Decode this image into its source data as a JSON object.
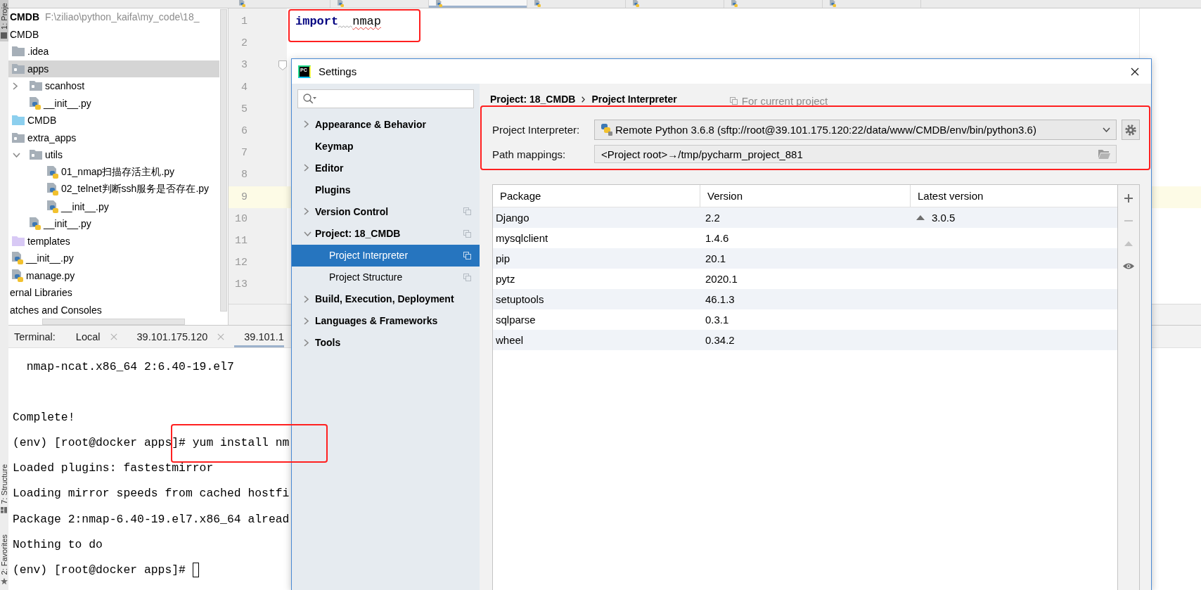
{
  "tool_windows": [
    {
      "kind": "project",
      "label": "1: Proje",
      "selected": true
    },
    {
      "kind": "structure",
      "label": "7: Structure",
      "selected": false
    },
    {
      "kind": "favorites",
      "label": "2: Favorites",
      "selected": false
    }
  ],
  "editor_tabs": [
    {
      "selected": false
    },
    {
      "selected": false
    },
    {
      "selected": true
    },
    {
      "selected": false
    },
    {
      "selected": false
    },
    {
      "selected": false
    },
    {
      "selected": false
    }
  ],
  "project_tree": {
    "items": [
      {
        "kind": "root",
        "label": "CMDB",
        "path": "F:\\ziliao\\python_kaifa\\my_code\\18_",
        "selected": false
      },
      {
        "kind": "label",
        "label": "CMDB",
        "selected": false,
        "children": [
          {
            "kind": "folder",
            "label": ".idea",
            "selected": false
          },
          {
            "kind": "package",
            "label": "apps",
            "selected": true,
            "children": [
              {
                "kind": "package",
                "label": "scanhost",
                "selected": false,
                "expanded": false
              },
              {
                "kind": "python_file",
                "label": "__init__.py",
                "selected": false
              }
            ]
          },
          {
            "kind": "source_folder",
            "label": "CMDB",
            "selected": false
          },
          {
            "kind": "package",
            "label": "extra_apps",
            "selected": false,
            "children": [
              {
                "kind": "package",
                "label": "utils",
                "selected": false,
                "expanded": true,
                "children": [
                  {
                    "kind": "python_file",
                    "label": "01_nmap扫描存活主机.py",
                    "selected": false
                  },
                  {
                    "kind": "python_file",
                    "label": "02_telnet判断ssh服务是否存在.py",
                    "selected": false
                  },
                  {
                    "kind": "python_file",
                    "label": "__init__.py",
                    "selected": false
                  }
                ]
              },
              {
                "kind": "python_file",
                "label": "__init__.py",
                "selected": false
              }
            ]
          },
          {
            "kind": "template_folder",
            "label": "templates",
            "selected": false
          },
          {
            "kind": "python_file",
            "label": "__init__.py",
            "selected": false
          },
          {
            "kind": "python_file",
            "label": "manage.py",
            "selected": false
          }
        ]
      },
      {
        "kind": "label",
        "label": "ernal Libraries",
        "selected": false
      },
      {
        "kind": "label",
        "label": "atches and Consoles",
        "selected": false
      }
    ]
  },
  "editor": {
    "lines": [
      {
        "number": "1",
        "tokens": [
          {
            "kind": "keyword",
            "text": "import",
            "warning_after": true,
            "error": false
          },
          {
            "kind": "name",
            "text": "nmap",
            "warning_after": false,
            "error": true
          }
        ],
        "current": false,
        "fold": false,
        "marked": true
      },
      {
        "number": "2",
        "current": false,
        "fold": false,
        "marked": false
      },
      {
        "number": "3",
        "current": false,
        "fold": true,
        "marked": false
      },
      {
        "number": "4",
        "current": false,
        "fold": false,
        "marked": false
      },
      {
        "number": "5",
        "current": false,
        "fold": false,
        "marked": false
      },
      {
        "number": "6",
        "current": false,
        "fold": false,
        "marked": false
      },
      {
        "number": "7",
        "current": false,
        "fold": false,
        "marked": false
      },
      {
        "number": "8",
        "current": false,
        "fold": false,
        "marked": false
      },
      {
        "number": "9",
        "current": true,
        "fold": false,
        "marked": false
      },
      {
        "number": "10",
        "current": false,
        "fold": false,
        "marked": false
      },
      {
        "number": "11",
        "current": false,
        "fold": false,
        "marked": false
      },
      {
        "number": "12",
        "current": false,
        "fold": false,
        "marked": false
      },
      {
        "number": "13",
        "current": false,
        "fold": false,
        "marked": false
      }
    ]
  },
  "terminal": {
    "title": "Terminal:",
    "tabs": [
      {
        "label": "Local",
        "closable": true,
        "selected": false
      },
      {
        "label": "39.101.175.120",
        "closable": true,
        "selected": false
      },
      {
        "label": "39.101.1",
        "closable": false,
        "selected": true
      }
    ],
    "blocks": [
      {
        "lines": [
          {
            "text": "  nmap-ncat.x86_64 2:6.40-19.el7",
            "marked": false,
            "cursor": false
          }
        ]
      },
      {
        "lines": [
          {
            "text": "Complete!",
            "marked": false,
            "cursor": false
          },
          {
            "text": "(env) [root@docker apps]# yum install nm",
            "marked": true,
            "cursor": false
          },
          {
            "text": "Loaded plugins: fastestmirror",
            "marked": false,
            "cursor": false
          },
          {
            "text": "Loading mirror speeds from cached hostfi",
            "marked": false,
            "cursor": false
          },
          {
            "text": "Package 2:nmap-6.40-19.el7.x86_64 alread",
            "marked": false,
            "cursor": false
          },
          {
            "text": "Nothing to do",
            "marked": false,
            "cursor": false
          },
          {
            "text": "(env) [root@docker apps]#",
            "marked": false,
            "cursor": true
          }
        ]
      }
    ]
  },
  "settings_dialog": {
    "logo_text": "PC",
    "title": "Settings",
    "nav": [
      {
        "label": "Appearance & Behavior",
        "expanded": false,
        "project_level": false,
        "selected": false
      },
      {
        "label": "Keymap",
        "project_level": false,
        "selected": false
      },
      {
        "label": "Editor",
        "expanded": false,
        "project_level": false,
        "selected": false
      },
      {
        "label": "Plugins",
        "project_level": false,
        "selected": false
      },
      {
        "label": "Version Control",
        "expanded": false,
        "project_level": true,
        "selected": false
      },
      {
        "label": "Project: 18_CMDB",
        "expanded": true,
        "project_level": true,
        "selected": false,
        "children": [
          {
            "label": "Project Interpreter",
            "project_level": true,
            "selected": true
          },
          {
            "label": "Project Structure",
            "project_level": true,
            "selected": false
          }
        ]
      },
      {
        "label": "Build, Execution, Deployment",
        "expanded": false,
        "project_level": false,
        "selected": false
      },
      {
        "label": "Languages & Frameworks",
        "expanded": false,
        "project_level": false,
        "selected": false
      },
      {
        "label": "Tools",
        "expanded": false,
        "project_level": false,
        "selected": false
      }
    ],
    "breadcrumb": [
      "Project: 18_CMDB",
      "Project Interpreter"
    ],
    "scope_note": "For current project",
    "interpreter_settings": {
      "marked": true,
      "interpreter": {
        "label": "Project Interpreter:",
        "value": "Remote Python 3.6.8 (sftp://root@39.101.175.120:22/data/www/CMDB/env/bin/python3.6)"
      },
      "path_mappings": {
        "label": "Path mappings:",
        "value": "<Project root>→/tmp/pycharm_project_881"
      }
    },
    "packages": {
      "columns": [
        "Package",
        "Version",
        "Latest version"
      ],
      "rows": [
        {
          "package": "Django",
          "version": "2.2",
          "latest": "3.0.5",
          "upgrade": true
        },
        {
          "package": "mysqlclient",
          "version": "1.4.6",
          "upgrade": false
        },
        {
          "package": "pip",
          "version": "20.1",
          "upgrade": false
        },
        {
          "package": "pytz",
          "version": "2020.1",
          "upgrade": false
        },
        {
          "package": "setuptools",
          "version": "46.1.3",
          "upgrade": false
        },
        {
          "package": "sqlparse",
          "version": "0.3.1",
          "upgrade": false
        },
        {
          "package": "wheel",
          "version": "0.34.2",
          "upgrade": false
        }
      ]
    },
    "toolbar": [
      {
        "kind": "add",
        "disabled": false
      },
      {
        "kind": "remove",
        "disabled": true
      },
      {
        "kind": "upgrade",
        "disabled": true
      },
      {
        "kind": "show_early_releases",
        "disabled": false
      }
    ]
  }
}
